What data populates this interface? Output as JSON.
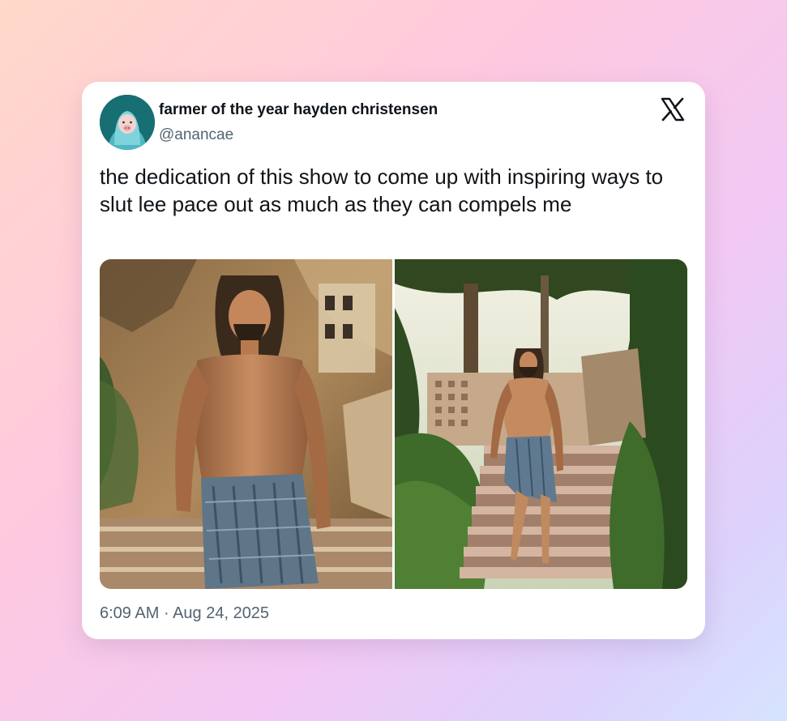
{
  "tweet": {
    "display_name": "farmer of the year hayden christensen",
    "handle": "@anancae",
    "text": "the dedication of this show to come up with inspiring ways to slut lee pace out as much as they can compels me",
    "time": "6:09 AM",
    "separator": " · ",
    "date": "Aug 24, 2025"
  },
  "icons": {
    "platform_logo": "x-logo-icon",
    "avatar": "avatar-image"
  },
  "media": [
    {
      "description_name": "photo-man-stone-steps"
    },
    {
      "description_name": "photo-man-garden-stairs"
    }
  ],
  "colors": {
    "text_primary": "#0f1419",
    "text_secondary": "#536471",
    "card_background": "#ffffff",
    "avatar_background": "#176f74"
  }
}
